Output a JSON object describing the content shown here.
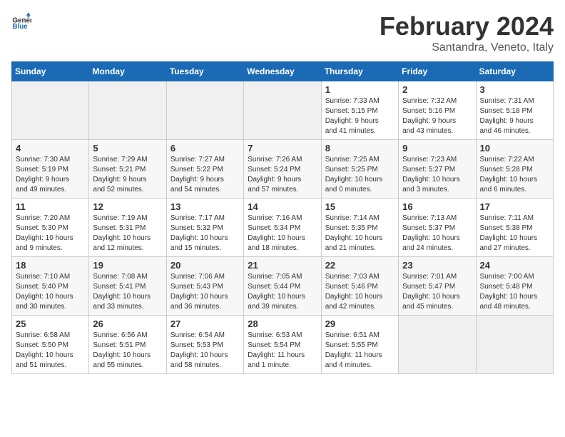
{
  "logo": {
    "text_general": "General",
    "text_blue": "Blue"
  },
  "title": "February 2024",
  "subtitle": "Santandra, Veneto, Italy",
  "headers": [
    "Sunday",
    "Monday",
    "Tuesday",
    "Wednesday",
    "Thursday",
    "Friday",
    "Saturday"
  ],
  "weeks": [
    [
      {
        "day": "",
        "info": ""
      },
      {
        "day": "",
        "info": ""
      },
      {
        "day": "",
        "info": ""
      },
      {
        "day": "",
        "info": ""
      },
      {
        "day": "1",
        "info": "Sunrise: 7:33 AM\nSunset: 5:15 PM\nDaylight: 9 hours\nand 41 minutes."
      },
      {
        "day": "2",
        "info": "Sunrise: 7:32 AM\nSunset: 5:16 PM\nDaylight: 9 hours\nand 43 minutes."
      },
      {
        "day": "3",
        "info": "Sunrise: 7:31 AM\nSunset: 5:18 PM\nDaylight: 9 hours\nand 46 minutes."
      }
    ],
    [
      {
        "day": "4",
        "info": "Sunrise: 7:30 AM\nSunset: 5:19 PM\nDaylight: 9 hours\nand 49 minutes."
      },
      {
        "day": "5",
        "info": "Sunrise: 7:29 AM\nSunset: 5:21 PM\nDaylight: 9 hours\nand 52 minutes."
      },
      {
        "day": "6",
        "info": "Sunrise: 7:27 AM\nSunset: 5:22 PM\nDaylight: 9 hours\nand 54 minutes."
      },
      {
        "day": "7",
        "info": "Sunrise: 7:26 AM\nSunset: 5:24 PM\nDaylight: 9 hours\nand 57 minutes."
      },
      {
        "day": "8",
        "info": "Sunrise: 7:25 AM\nSunset: 5:25 PM\nDaylight: 10 hours\nand 0 minutes."
      },
      {
        "day": "9",
        "info": "Sunrise: 7:23 AM\nSunset: 5:27 PM\nDaylight: 10 hours\nand 3 minutes."
      },
      {
        "day": "10",
        "info": "Sunrise: 7:22 AM\nSunset: 5:28 PM\nDaylight: 10 hours\nand 6 minutes."
      }
    ],
    [
      {
        "day": "11",
        "info": "Sunrise: 7:20 AM\nSunset: 5:30 PM\nDaylight: 10 hours\nand 9 minutes."
      },
      {
        "day": "12",
        "info": "Sunrise: 7:19 AM\nSunset: 5:31 PM\nDaylight: 10 hours\nand 12 minutes."
      },
      {
        "day": "13",
        "info": "Sunrise: 7:17 AM\nSunset: 5:32 PM\nDaylight: 10 hours\nand 15 minutes."
      },
      {
        "day": "14",
        "info": "Sunrise: 7:16 AM\nSunset: 5:34 PM\nDaylight: 10 hours\nand 18 minutes."
      },
      {
        "day": "15",
        "info": "Sunrise: 7:14 AM\nSunset: 5:35 PM\nDaylight: 10 hours\nand 21 minutes."
      },
      {
        "day": "16",
        "info": "Sunrise: 7:13 AM\nSunset: 5:37 PM\nDaylight: 10 hours\nand 24 minutes."
      },
      {
        "day": "17",
        "info": "Sunrise: 7:11 AM\nSunset: 5:38 PM\nDaylight: 10 hours\nand 27 minutes."
      }
    ],
    [
      {
        "day": "18",
        "info": "Sunrise: 7:10 AM\nSunset: 5:40 PM\nDaylight: 10 hours\nand 30 minutes."
      },
      {
        "day": "19",
        "info": "Sunrise: 7:08 AM\nSunset: 5:41 PM\nDaylight: 10 hours\nand 33 minutes."
      },
      {
        "day": "20",
        "info": "Sunrise: 7:06 AM\nSunset: 5:43 PM\nDaylight: 10 hours\nand 36 minutes."
      },
      {
        "day": "21",
        "info": "Sunrise: 7:05 AM\nSunset: 5:44 PM\nDaylight: 10 hours\nand 39 minutes."
      },
      {
        "day": "22",
        "info": "Sunrise: 7:03 AM\nSunset: 5:46 PM\nDaylight: 10 hours\nand 42 minutes."
      },
      {
        "day": "23",
        "info": "Sunrise: 7:01 AM\nSunset: 5:47 PM\nDaylight: 10 hours\nand 45 minutes."
      },
      {
        "day": "24",
        "info": "Sunrise: 7:00 AM\nSunset: 5:48 PM\nDaylight: 10 hours\nand 48 minutes."
      }
    ],
    [
      {
        "day": "25",
        "info": "Sunrise: 6:58 AM\nSunset: 5:50 PM\nDaylight: 10 hours\nand 51 minutes."
      },
      {
        "day": "26",
        "info": "Sunrise: 6:56 AM\nSunset: 5:51 PM\nDaylight: 10 hours\nand 55 minutes."
      },
      {
        "day": "27",
        "info": "Sunrise: 6:54 AM\nSunset: 5:53 PM\nDaylight: 10 hours\nand 58 minutes."
      },
      {
        "day": "28",
        "info": "Sunrise: 6:53 AM\nSunset: 5:54 PM\nDaylight: 11 hours\nand 1 minute."
      },
      {
        "day": "29",
        "info": "Sunrise: 6:51 AM\nSunset: 5:55 PM\nDaylight: 11 hours\nand 4 minutes."
      },
      {
        "day": "",
        "info": ""
      },
      {
        "day": "",
        "info": ""
      }
    ]
  ]
}
